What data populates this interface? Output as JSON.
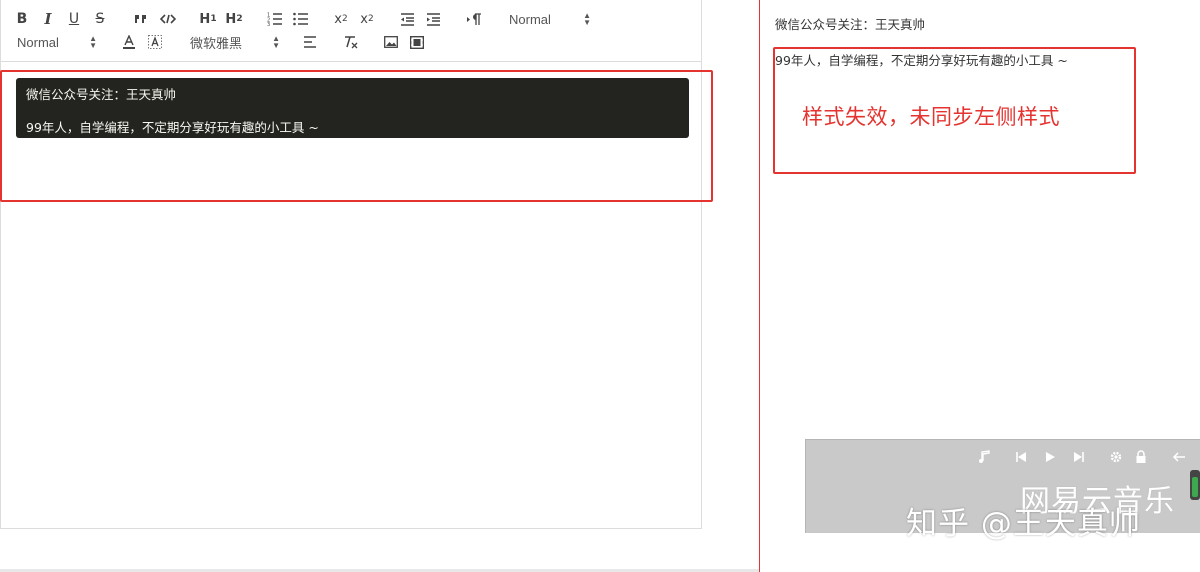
{
  "toolbar": {
    "bold": "B",
    "italic": "I",
    "underline": "U",
    "strike": "S",
    "h1": "H",
    "h1_sub": "1",
    "h2": "H",
    "h2_sub": "2",
    "subscript": "x",
    "subscript_sub": "2",
    "superscript": "x",
    "superscript_sup": "2",
    "header_picker": "Normal",
    "size_picker": "Normal",
    "font_picker": "微软雅黑"
  },
  "editor": {
    "line1": "微信公众号关注：王天真帅",
    "line2": "99年人，自学编程，不定期分享好玩有趣的小工具 ~"
  },
  "preview": {
    "line1": "微信公众号关注：王天真帅",
    "line2": "99年人，自学编程，不定期分享好玩有趣的小工具 ~",
    "annotation": "样式失效，未同步左侧样式"
  },
  "player": {
    "title": "网易云音乐"
  },
  "watermark": "知乎 @王天真帅",
  "colors": {
    "highlight_red": "#e5332f",
    "code_bg": "#23241f"
  }
}
